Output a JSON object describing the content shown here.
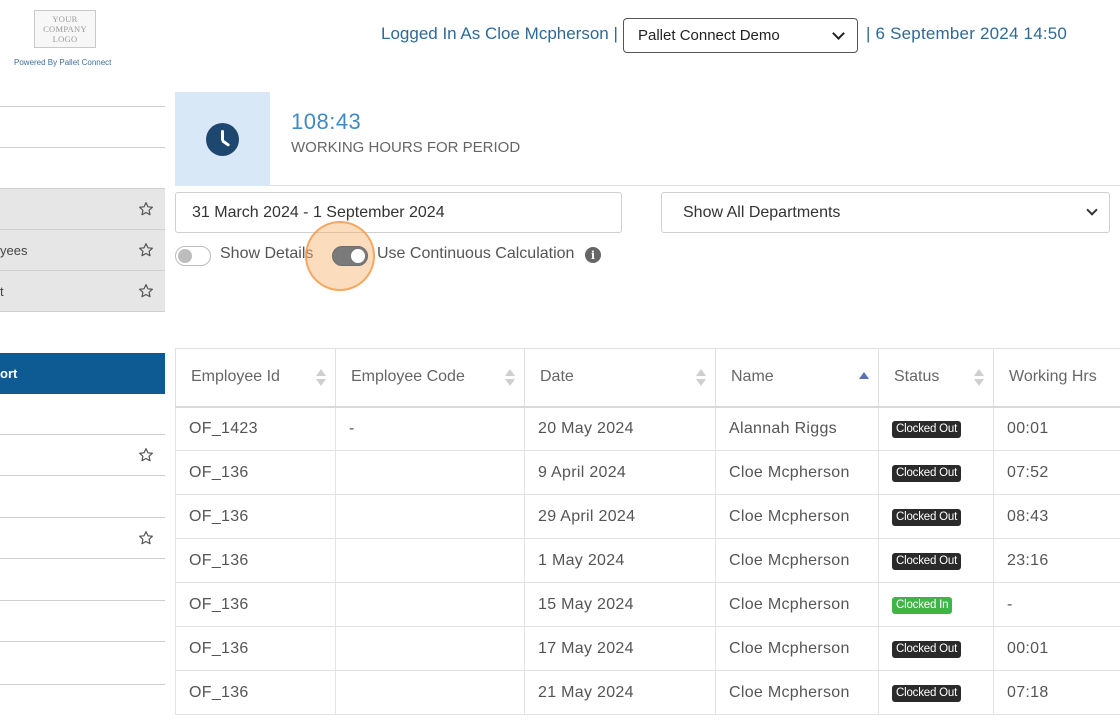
{
  "header": {
    "logo_lines": [
      "YOUR",
      "COMPANY",
      "LOGO"
    ],
    "powered_by": "Powered By Pallet Connect",
    "logged_in_text": "Logged In As Cloe Mcpherson |",
    "company_select": "Pallet Connect Demo",
    "datetime_text": "| 6 September 2024 14:50"
  },
  "sidebar": {
    "items": [
      {
        "label": "",
        "starred": false
      },
      {
        "label": "",
        "starred": false
      },
      {
        "label": "",
        "starred": false
      },
      {
        "label": "",
        "starred": true
      },
      {
        "label": "yees",
        "starred": true
      },
      {
        "label": "t",
        "starred": true
      },
      {
        "label": "ort",
        "starred": false
      },
      {
        "label": "",
        "starred": false
      },
      {
        "label": "",
        "starred": true
      },
      {
        "label": "",
        "starred": false
      },
      {
        "label": "",
        "starred": true
      },
      {
        "label": "",
        "starred": false
      },
      {
        "label": "",
        "starred": false
      },
      {
        "label": "",
        "starred": false
      }
    ]
  },
  "summary": {
    "value": "108:43",
    "label": "WORKING HOURS FOR PERIOD"
  },
  "filters": {
    "date_range": "31 March 2024 - 1 September 2024",
    "department": "Show All Departments",
    "show_details_label": "Show Details",
    "show_details_on": false,
    "continuous_label": "Use Continuous Calculation",
    "continuous_on": true
  },
  "table": {
    "headers": [
      "Employee Id",
      "Employee Code",
      "Date",
      "Name",
      "Status",
      "Working Hrs"
    ],
    "rows": [
      {
        "id": "OF_1423",
        "code": "-",
        "date": "20 May 2024",
        "name": "Alannah Riggs",
        "status": "Clocked Out",
        "hours": "00:01"
      },
      {
        "id": "OF_136",
        "code": "",
        "date": "9 April 2024",
        "name": "Cloe Mcpherson",
        "status": "Clocked Out",
        "hours": "07:52"
      },
      {
        "id": "OF_136",
        "code": "",
        "date": "29 April 2024",
        "name": "Cloe Mcpherson",
        "status": "Clocked Out",
        "hours": "08:43"
      },
      {
        "id": "OF_136",
        "code": "",
        "date": "1 May 2024",
        "name": "Cloe Mcpherson",
        "status": "Clocked Out",
        "hours": "23:16"
      },
      {
        "id": "OF_136",
        "code": "",
        "date": "15 May 2024",
        "name": "Cloe Mcpherson",
        "status": "Clocked In",
        "hours": "-"
      },
      {
        "id": "OF_136",
        "code": "",
        "date": "17 May 2024",
        "name": "Cloe Mcpherson",
        "status": "Clocked Out",
        "hours": "00:01"
      },
      {
        "id": "OF_136",
        "code": "",
        "date": "21 May 2024",
        "name": "Cloe Mcpherson",
        "status": "Clocked Out",
        "hours": "07:18"
      }
    ]
  },
  "colors": {
    "brand_blue": "#0e5b94",
    "link_blue": "#2d6a9a",
    "status_out": "#2a2a2a",
    "status_in": "#3fb548"
  }
}
